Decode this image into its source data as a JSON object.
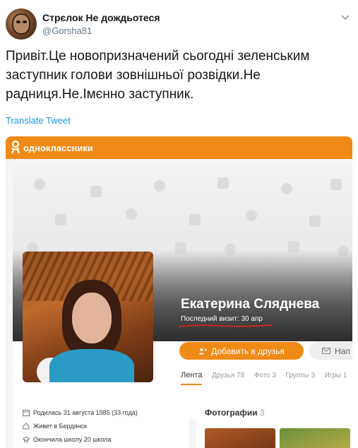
{
  "tweet": {
    "display_name": "Стрєлок Не дождьотеся",
    "handle": "@Gorsha81",
    "text": "Привіт.Це новопризначений сьогодні зеленським заступник голови зовнішньої розвідки.Не радниця.Не.Імєнно заступник.",
    "translate_label": "Translate Tweet"
  },
  "embed": {
    "brand": "одноклассники",
    "profile": {
      "name": "Екатерина Сляднева",
      "last_visit": "Последний визит: 30 апр",
      "add_friend_label": "Добавить в друзья",
      "message_label": "Нап"
    },
    "tabs": [
      {
        "label": "Лента",
        "active": true
      },
      {
        "label": "Друзья 78",
        "active": false
      },
      {
        "label": "Фото 3",
        "active": false
      },
      {
        "label": "Группы 3",
        "active": false
      },
      {
        "label": "Игры 1",
        "active": false
      }
    ],
    "info": [
      {
        "icon": "calendar-icon",
        "text": "Родилась 31 августа 1985 (33 года)"
      },
      {
        "icon": "home-icon",
        "text": "Живет в Бердянск"
      },
      {
        "icon": "school-icon",
        "text": "Окончила школу 20 школа"
      }
    ],
    "photos": {
      "title": "Фотографии",
      "count": "3"
    }
  },
  "colors": {
    "ok_orange": "#f08a17",
    "twitter_blue": "#1b95e0",
    "annotation_red": "#e0261c"
  }
}
